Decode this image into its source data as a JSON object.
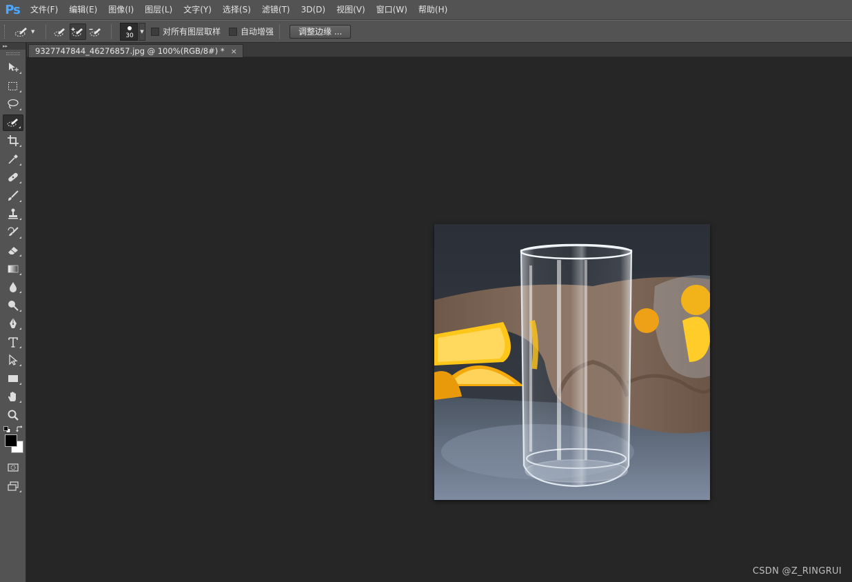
{
  "app": {
    "logo": "Ps",
    "menu": [
      "文件(F)",
      "编辑(E)",
      "图像(I)",
      "图层(L)",
      "文字(Y)",
      "选择(S)",
      "滤镜(T)",
      "3D(D)",
      "视图(V)",
      "窗口(W)",
      "帮助(H)"
    ]
  },
  "options": {
    "tool_icon": "quick-selection-icon",
    "brush_size": "30",
    "sample_all_layers_label": "对所有图层取样",
    "sample_all_layers_checked": false,
    "auto_enhance_label": "自动增强",
    "auto_enhance_checked": false,
    "refine_edge_label": "调整边缘 ..."
  },
  "tabbar": {
    "panel_toggle": "▸▸"
  },
  "document": {
    "tab_title": "9327747844_46276857.jpg @ 100%(RGB/8#) *",
    "close_glyph": "×",
    "image_description_icon": "glass-photo"
  },
  "tools": [
    {
      "name": "move-tool",
      "icon": "move-icon"
    },
    {
      "name": "marquee-tool",
      "icon": "rect-marquee-icon"
    },
    {
      "name": "lasso-tool",
      "icon": "lasso-icon"
    },
    {
      "name": "quick-selection-tool",
      "icon": "quick-selection-icon",
      "active": true
    },
    {
      "name": "crop-tool",
      "icon": "crop-icon"
    },
    {
      "name": "eyedropper-tool",
      "icon": "eyedropper-icon"
    },
    {
      "name": "healing-brush-tool",
      "icon": "bandage-icon"
    },
    {
      "name": "brush-tool",
      "icon": "brush-icon"
    },
    {
      "name": "clone-stamp-tool",
      "icon": "stamp-icon"
    },
    {
      "name": "history-brush-tool",
      "icon": "history-brush-icon"
    },
    {
      "name": "eraser-tool",
      "icon": "eraser-icon"
    },
    {
      "name": "gradient-tool",
      "icon": "gradient-icon"
    },
    {
      "name": "blur-tool",
      "icon": "blur-drop-icon"
    },
    {
      "name": "dodge-tool",
      "icon": "dodge-icon"
    },
    {
      "name": "pen-tool",
      "icon": "pen-icon"
    },
    {
      "name": "type-tool",
      "icon": "type-icon"
    },
    {
      "name": "path-selection-tool",
      "icon": "path-selection-icon"
    },
    {
      "name": "rectangle-tool",
      "icon": "rectangle-icon"
    },
    {
      "name": "hand-tool",
      "icon": "hand-icon"
    },
    {
      "name": "zoom-tool",
      "icon": "zoom-icon"
    }
  ],
  "colors": {
    "foreground": "#000000",
    "background": "#ffffff",
    "ps_blue": "#4da6ff",
    "ui_gray": "#535353",
    "canvas_bg": "#262626"
  },
  "watermark": "CSDN @Z_RINGRUI"
}
